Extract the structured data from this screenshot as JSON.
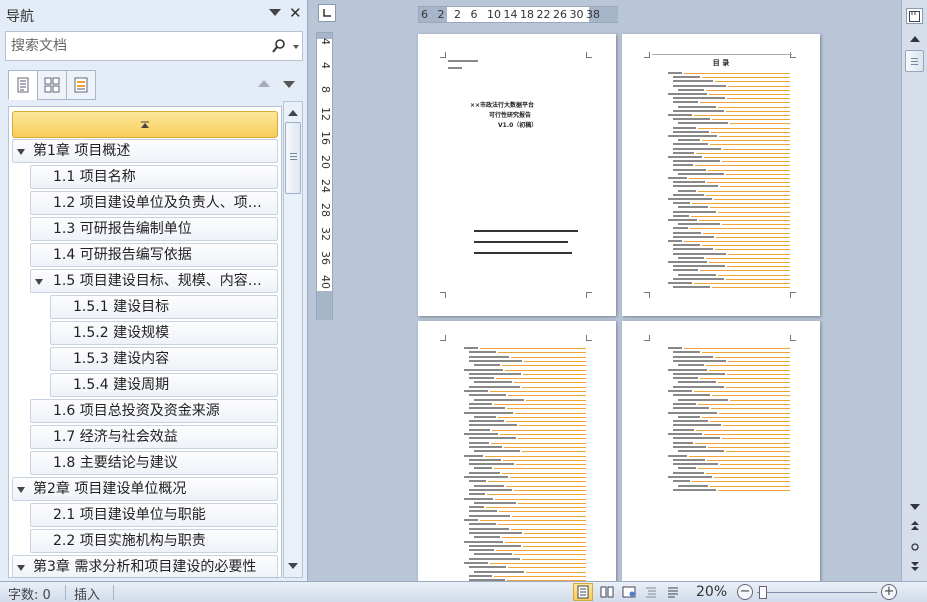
{
  "nav": {
    "title": "导航",
    "search_placeholder": "搜索文档",
    "tree": [
      {
        "label": "第1章 项目概述",
        "level": 1,
        "expanded": true
      },
      {
        "label": "1.1 项目名称",
        "level": 2
      },
      {
        "label": "1.2 项目建设单位及负责人、项…",
        "level": 2
      },
      {
        "label": "1.3 可研报告编制单位",
        "level": 2
      },
      {
        "label": "1.4 可研报告编写依据",
        "level": 2
      },
      {
        "label": "1.5 项目建设目标、规模、内容…",
        "level": 2,
        "expanded": true
      },
      {
        "label": "1.5.1 建设目标",
        "level": 3
      },
      {
        "label": "1.5.2 建设规模",
        "level": 3
      },
      {
        "label": "1.5.3 建设内容",
        "level": 3
      },
      {
        "label": "1.5.4 建设周期",
        "level": 3
      },
      {
        "label": "1.6 项目总投资及资金来源",
        "level": 2
      },
      {
        "label": "1.7 经济与社会效益",
        "level": 2
      },
      {
        "label": "1.8 主要结论与建议",
        "level": 2
      },
      {
        "label": "第2章 项目建设单位概况",
        "level": 1,
        "expanded": true
      },
      {
        "label": "2.1 项目建设单位与职能",
        "level": 2
      },
      {
        "label": "2.2 项目实施机构与职责",
        "level": 2
      },
      {
        "label": "第3章 需求分析和项目建设的必要性",
        "level": 1,
        "expanded": true
      }
    ]
  },
  "ruler": {
    "horizontal": [
      "6",
      "2",
      "2",
      "6",
      "10",
      "14",
      "18",
      "22",
      "26",
      "30",
      "38"
    ],
    "vertical": [
      "4",
      "4",
      "8",
      "12",
      "16",
      "20",
      "24",
      "28",
      "32",
      "36",
      "40"
    ]
  },
  "document": {
    "cover": {
      "title_lines": [
        "××市政法行大数据平台",
        "可行性研究报告",
        "V1.0（初稿）"
      ]
    },
    "toc_title": "目  录"
  },
  "status": {
    "word_count": "字数: 0",
    "insert_mode": "插入",
    "zoom": "20%",
    "zoom_level": 0.2
  },
  "colors": {
    "accent_yellow": "#f7cd5b",
    "toc_dots": "#f1a33a",
    "workspace": "#b9c6d8"
  }
}
